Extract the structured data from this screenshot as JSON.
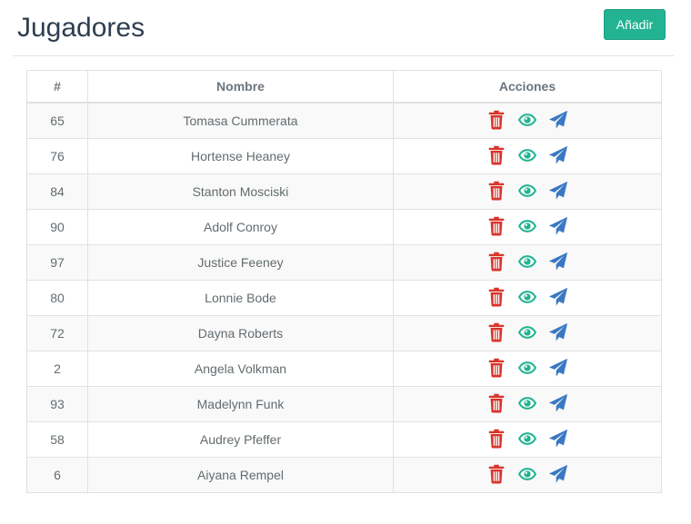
{
  "header": {
    "title": "Jugadores",
    "add_label": "Añadir"
  },
  "table": {
    "columns": [
      "#",
      "Nombre",
      "Acciones"
    ],
    "rows": [
      {
        "id": "65",
        "name": "Tomasa Cummerata"
      },
      {
        "id": "76",
        "name": "Hortense Heaney"
      },
      {
        "id": "84",
        "name": "Stanton Mosciski"
      },
      {
        "id": "90",
        "name": "Adolf Conroy"
      },
      {
        "id": "97",
        "name": "Justice Feeney"
      },
      {
        "id": "80",
        "name": "Lonnie Bode"
      },
      {
        "id": "72",
        "name": "Dayna Roberts"
      },
      {
        "id": "2",
        "name": "Angela Volkman"
      },
      {
        "id": "93",
        "name": "Madelynn Funk"
      },
      {
        "id": "58",
        "name": "Audrey Pfeffer"
      },
      {
        "id": "6",
        "name": "Aiyana Rempel"
      }
    ],
    "row_actions": [
      "trash-icon",
      "eye-icon",
      "paper-plane-icon"
    ]
  },
  "colors": {
    "primary_button": "#23b393",
    "delete_icon": "#d9342b",
    "view_icon": "#23b393",
    "send_icon": "#3a78c3",
    "title": "#2d3e50"
  }
}
